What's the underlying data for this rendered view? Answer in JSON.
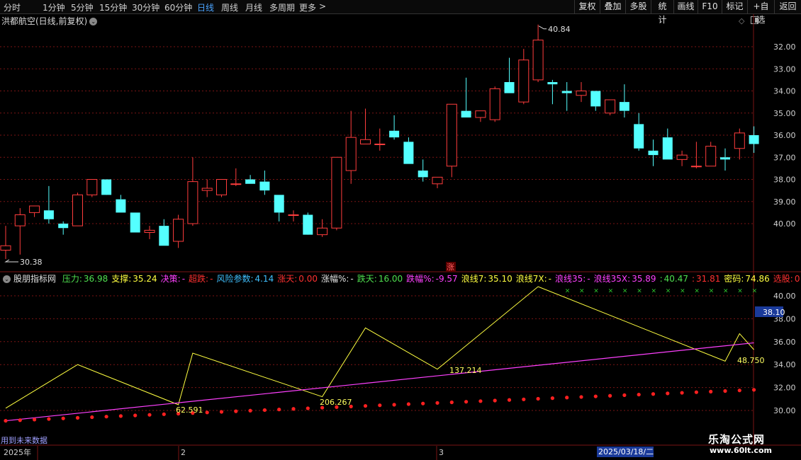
{
  "toolbar": {
    "periods": [
      "分时",
      "1分钟",
      "5分钟",
      "15分钟",
      "30分钟",
      "60分钟",
      "日线",
      "周线",
      "月线",
      "多周期",
      "更多"
    ],
    "more_chevron": ">",
    "active_period": "日线",
    "actions": [
      "复权",
      "叠加",
      "多股",
      "统计",
      "画线",
      "F10",
      "+自选",
      "返回"
    ],
    "mark_label": "标记"
  },
  "stock": {
    "name_line": "洪都航空(日线,前复权)",
    "high_label": "40.84",
    "low_label": "30.38",
    "zhang_badge": "涨"
  },
  "price_axis": {
    "ticks": [
      "40.00",
      "39.00",
      "38.00",
      "37.00",
      "36.00",
      "35.00",
      "34.00",
      "33.00",
      "32.00"
    ]
  },
  "indicator": {
    "title": "股朋指标网",
    "items": [
      {
        "label": "压力:",
        "value": "36.98",
        "lc": "#4fe04f",
        "vc": "#4fe04f"
      },
      {
        "label": "支撑:",
        "value": "35.24",
        "lc": "#ffff40",
        "vc": "#ffff40"
      },
      {
        "label": "决策:",
        "value": "-",
        "lc": "#ff40ff",
        "vc": "#ff40ff"
      },
      {
        "label": "超跌:",
        "value": "-",
        "lc": "#ff3030",
        "vc": "#ff3030"
      },
      {
        "label": "风险参数:",
        "value": "4.14",
        "lc": "#40c0ff",
        "vc": "#40c0ff"
      },
      {
        "label": "涨天:",
        "value": "0.00",
        "lc": "#ff3030",
        "vc": "#ff3030"
      },
      {
        "label": "涨幅%:",
        "value": "-",
        "lc": "#e0e0e0",
        "vc": "#e0e0e0"
      },
      {
        "label": "跌天:",
        "value": "16.00",
        "lc": "#4fe04f",
        "vc": "#4fe04f"
      },
      {
        "label": "跌幅%:",
        "value": "-9.57",
        "lc": "#ff40ff",
        "vc": "#ff40ff"
      },
      {
        "label": "浪线7:",
        "value": "35.10",
        "lc": "#ffff40",
        "vc": "#ffff40"
      },
      {
        "label": "浪线7X:",
        "value": "-",
        "lc": "#ffff40",
        "vc": "#ffff40"
      },
      {
        "label": "浪线35:",
        "value": "-",
        "lc": "#ff40ff",
        "vc": "#ff40ff"
      },
      {
        "label": "浪线35X:",
        "value": "35.89",
        "lc": "#ff40ff",
        "vc": "#ff40ff"
      },
      {
        "label": ":",
        "value": "40.47",
        "lc": "#4fe04f",
        "vc": "#4fe04f"
      },
      {
        "label": ":",
        "value": "31.81",
        "lc": "#ff3030",
        "vc": "#ff3030"
      },
      {
        "label": "密码:",
        "value": "74.86",
        "lc": "#ffff40",
        "vc": "#ffff40"
      },
      {
        "label": "选股:",
        "value": "0",
        "lc": "#ff3030",
        "vc": "#ff3030"
      }
    ],
    "axis_ticks": [
      "40.00",
      "38.00",
      "36.00",
      "34.00",
      "32.00",
      "30.00"
    ],
    "current_tag": "38.10",
    "wave_labels": [
      "62.591",
      "206.267",
      "137.214",
      "48.750"
    ]
  },
  "timeline": {
    "labels": [
      "2025年",
      "2",
      "3"
    ],
    "cursor_date": "2025/03/18/二",
    "future_hint": "用到未来数据"
  },
  "watermark": {
    "line1": "乐淘公式网",
    "line2": "www.60lt.com"
  },
  "colors": {
    "up": "#ff3d3d",
    "down": "#54ffff",
    "grid": "#7a1414"
  },
  "chart_data": [
    {
      "type": "candlestick",
      "title": "洪都航空(日线,前复权)",
      "ylim": [
        31.5,
        40.8
      ],
      "yticks": [
        32,
        33,
        34,
        35,
        36,
        37,
        38,
        39,
        40
      ],
      "ohlc": [
        [
          30.8,
          31.9,
          30.4,
          31.0
        ],
        [
          31.9,
          32.7,
          30.6,
          32.4
        ],
        [
          32.5,
          32.8,
          32.3,
          32.8
        ],
        [
          32.6,
          33.7,
          32.0,
          32.2
        ],
        [
          32.0,
          32.1,
          31.5,
          31.8
        ],
        [
          31.9,
          33.4,
          31.9,
          33.3
        ],
        [
          33.3,
          34.0,
          33.2,
          34.0
        ],
        [
          34.0,
          34.0,
          33.8,
          33.3
        ],
        [
          33.1,
          33.3,
          32.5,
          32.5
        ],
        [
          32.5,
          32.5,
          31.7,
          31.6
        ],
        [
          31.6,
          31.9,
          31.3,
          31.7
        ],
        [
          31.9,
          32.2,
          31.0,
          31.0
        ],
        [
          31.2,
          32.4,
          30.9,
          32.2
        ],
        [
          32.0,
          35.0,
          31.9,
          33.9
        ],
        [
          33.5,
          34.0,
          33.2,
          33.6
        ],
        [
          33.3,
          34.0,
          33.2,
          34.0
        ],
        [
          33.8,
          34.5,
          33.7,
          33.8
        ],
        [
          34.0,
          34.2,
          33.8,
          33.8
        ],
        [
          33.9,
          34.4,
          33.3,
          33.5
        ],
        [
          33.3,
          33.3,
          32.1,
          32.5
        ],
        [
          32.4,
          32.6,
          32.1,
          32.4
        ],
        [
          32.4,
          32.5,
          31.6,
          31.5
        ],
        [
          31.5,
          32.2,
          31.4,
          31.8
        ],
        [
          31.8,
          35.0,
          31.7,
          35.0
        ],
        [
          34.4,
          37.1,
          33.8,
          35.9
        ],
        [
          35.6,
          37.2,
          35.6,
          35.8
        ],
        [
          35.6,
          36.3,
          35.3,
          35.6
        ],
        [
          36.2,
          36.9,
          35.8,
          35.9
        ],
        [
          35.7,
          35.9,
          34.7,
          34.7
        ],
        [
          34.4,
          34.9,
          33.9,
          34.1
        ],
        [
          33.8,
          34.0,
          33.6,
          34.1
        ],
        [
          34.6,
          37.4,
          34.1,
          37.4
        ],
        [
          37.1,
          38.6,
          36.8,
          36.8
        ],
        [
          36.8,
          37.1,
          36.6,
          37.1
        ],
        [
          36.7,
          38.2,
          36.6,
          38.1
        ],
        [
          38.4,
          39.5,
          37.9,
          37.9
        ],
        [
          37.5,
          39.9,
          37.4,
          39.4
        ],
        [
          38.5,
          41.0,
          38.4,
          40.3
        ],
        [
          38.4,
          38.5,
          37.4,
          38.3
        ],
        [
          38.0,
          38.4,
          37.1,
          37.9
        ],
        [
          37.8,
          38.4,
          37.5,
          38.0
        ],
        [
          38.0,
          38.0,
          37.1,
          37.3
        ],
        [
          37.0,
          37.6,
          36.9,
          37.6
        ],
        [
          37.5,
          38.3,
          36.8,
          37.1
        ],
        [
          36.5,
          37.0,
          35.3,
          35.4
        ],
        [
          35.3,
          35.8,
          34.6,
          35.1
        ],
        [
          35.9,
          36.3,
          34.9,
          34.9
        ],
        [
          34.9,
          35.3,
          34.6,
          35.1
        ],
        [
          34.6,
          35.7,
          34.5,
          34.6
        ],
        [
          34.6,
          35.7,
          34.6,
          35.5
        ],
        [
          35.0,
          35.4,
          34.4,
          34.9
        ],
        [
          35.4,
          36.3,
          34.9,
          36.1
        ],
        [
          36.0,
          36.4,
          35.2,
          35.6
        ]
      ]
    },
    {
      "type": "line",
      "title": "股朋指标网",
      "ylim": [
        29.1,
        41.3
      ],
      "series": [
        {
          "name": "浪线7",
          "points": [
            [
              0,
              30.2
            ],
            [
              5,
              34.0
            ],
            [
              12,
              30.5
            ],
            [
              13,
              35.0
            ],
            [
              22,
              31.2
            ],
            [
              25,
              37.2
            ],
            [
              30,
              33.6
            ],
            [
              37,
              40.8
            ],
            [
              50,
              34.3
            ],
            [
              51,
              36.7
            ],
            [
              52,
              35.3
            ]
          ]
        },
        {
          "name": "浪线35",
          "points": [
            [
              0,
              29.1
            ],
            [
              52,
              35.9
            ]
          ]
        },
        {
          "name": "",
          "type": "scatter",
          "x_start": 0,
          "x_end": 52,
          "y_start": 29.1,
          "y_end": 31.8
        },
        {
          "name": "",
          "type": "scatter",
          "x_start": 39,
          "x_end": 52,
          "y": 40.47
        }
      ]
    }
  ]
}
